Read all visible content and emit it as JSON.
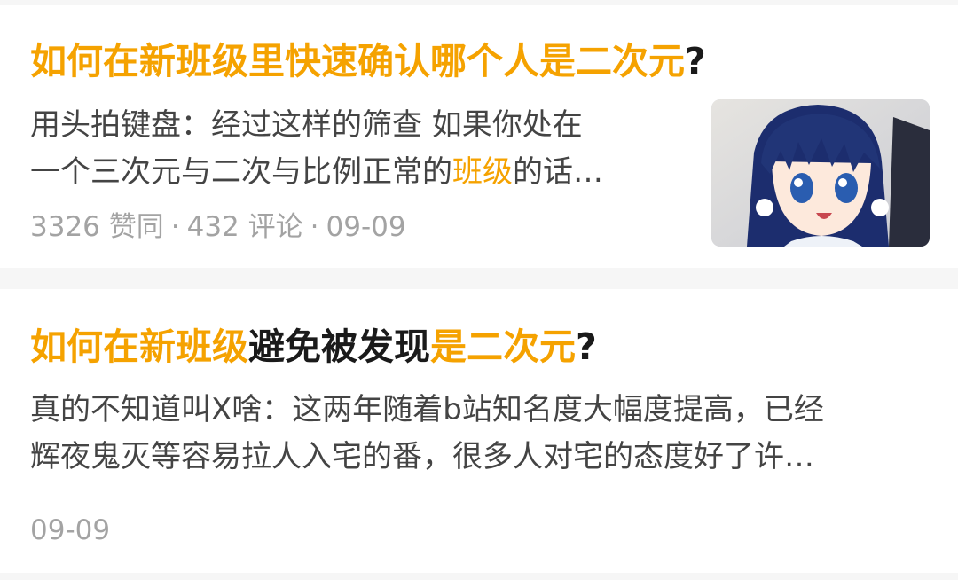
{
  "feed": {
    "items": [
      {
        "title_parts": [
          {
            "text": "如何在新班级里快速确认哪个人是二次元",
            "highlight": true
          },
          {
            "text": "?",
            "highlight": false
          }
        ],
        "excerpt_line1": "用头拍键盘：经过这样的筛查 如果你处在",
        "excerpt_line2_pre": "一个三次元与二次与比例正常的",
        "excerpt_line2_hl": "班级",
        "excerpt_line2_post": "的话…",
        "meta": {
          "likes": "3326 赞同",
          "comments": "432 评论",
          "date": "09-09",
          "separator": "·"
        },
        "thumbnail_icon": "anime-girl-thumbnail"
      },
      {
        "title_parts": [
          {
            "text": "如何在新班级",
            "highlight": true
          },
          {
            "text": "避免被发现",
            "highlight": false
          },
          {
            "text": "是二次元",
            "highlight": true
          },
          {
            "text": "?",
            "highlight": false
          }
        ],
        "excerpt_line1": "真的不知道叫X啥：这两年随着b站知名度大幅度提高，已经",
        "excerpt_line2": "辉夜鬼灭等容易拉人入宅的番，很多人对宅的态度好了许…",
        "meta": {
          "date": "09-09"
        }
      }
    ]
  },
  "colors": {
    "highlight": "#f5a200",
    "title": "#1a1a1a",
    "excerpt": "#444444",
    "meta": "#a3a3a3",
    "background": "#f6f6f6"
  }
}
